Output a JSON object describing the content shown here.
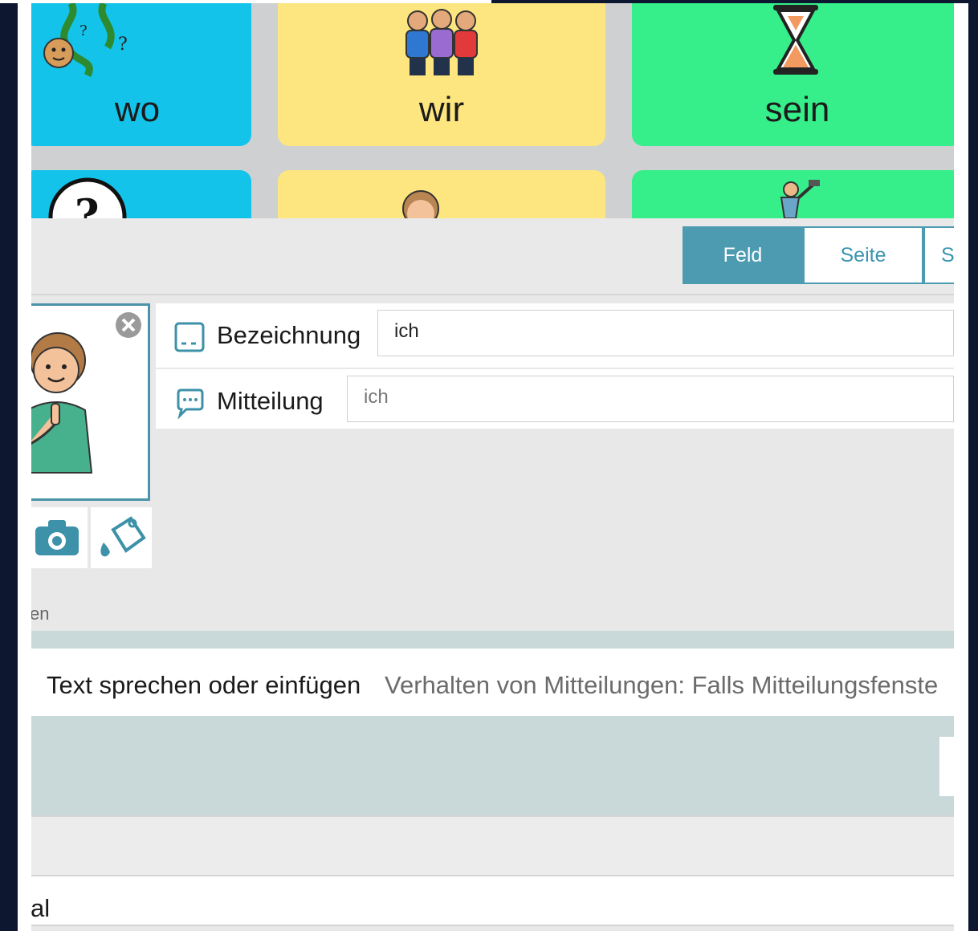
{
  "grid": {
    "tiles": [
      {
        "label": "wo",
        "icon": "question-vines-icon",
        "color": "#13c3ea"
      },
      {
        "label": "wir",
        "icon": "group-of-people-icon",
        "color": "#fde67f"
      },
      {
        "label": "sein",
        "icon": "hourglass-icon",
        "color": "#36ef8a"
      },
      {
        "label": "",
        "icon": "clock-question-icon",
        "color": "#13c3ea"
      },
      {
        "label": "",
        "icon": "person-icon",
        "color": "#fde67f"
      },
      {
        "label": "",
        "icon": "worker-hammer-icon",
        "color": "#36ef8a"
      }
    ]
  },
  "tabs": [
    {
      "label": "Feld",
      "active": true
    },
    {
      "label": "Seite",
      "active": false
    },
    {
      "label": "S",
      "active": false
    }
  ],
  "editor": {
    "symbol_icon": "person-pointing-self-icon",
    "fields": [
      {
        "icon": "label-box-icon",
        "label": "Bezeichnung",
        "value": "ich"
      },
      {
        "icon": "speech-bubble-icon",
        "label": "Mitteilung",
        "placeholder": "ich"
      }
    ],
    "tools": [
      {
        "icon": "camera-icon"
      },
      {
        "icon": "paint-bucket-icon"
      }
    ],
    "hint": "en"
  },
  "behavior": {
    "title": "Text sprechen oder einfügen",
    "description": "Verhalten von Mitteilungen: Falls Mitteilungsfenste"
  },
  "footer": {
    "label": "al"
  },
  "colors": {
    "accent": "#4d9bb0",
    "blue_tile": "#13c3ea",
    "yellow_tile": "#fde67f",
    "green_tile": "#36ef8a"
  }
}
